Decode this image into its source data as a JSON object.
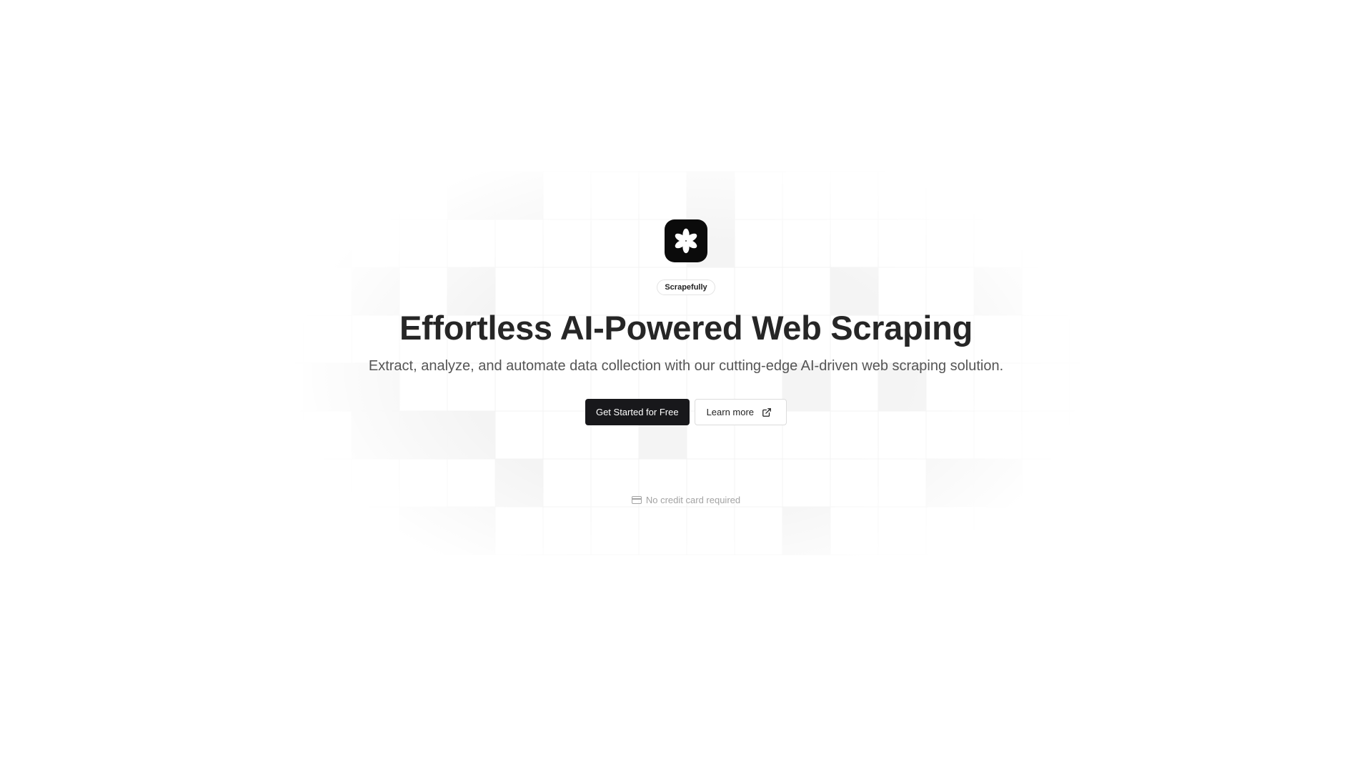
{
  "brand": {
    "badge": "Scrapefully",
    "logo_icon": "asterisk-flower-icon"
  },
  "hero": {
    "headline": "Effortless AI-Powered Web Scraping",
    "subheadline": "Extract, analyze, and automate data collection with our cutting-edge AI-driven web scraping solution."
  },
  "actions": {
    "primary_label": "Get Started for Free",
    "secondary_label": "Learn more",
    "secondary_icon": "external-link-icon"
  },
  "note": {
    "text": "No credit card required",
    "icon": "credit-card-icon"
  },
  "colors": {
    "primary_button": "#18181b",
    "headline": "#262626",
    "subheadline": "#555555",
    "muted": "#a3a3a3"
  }
}
